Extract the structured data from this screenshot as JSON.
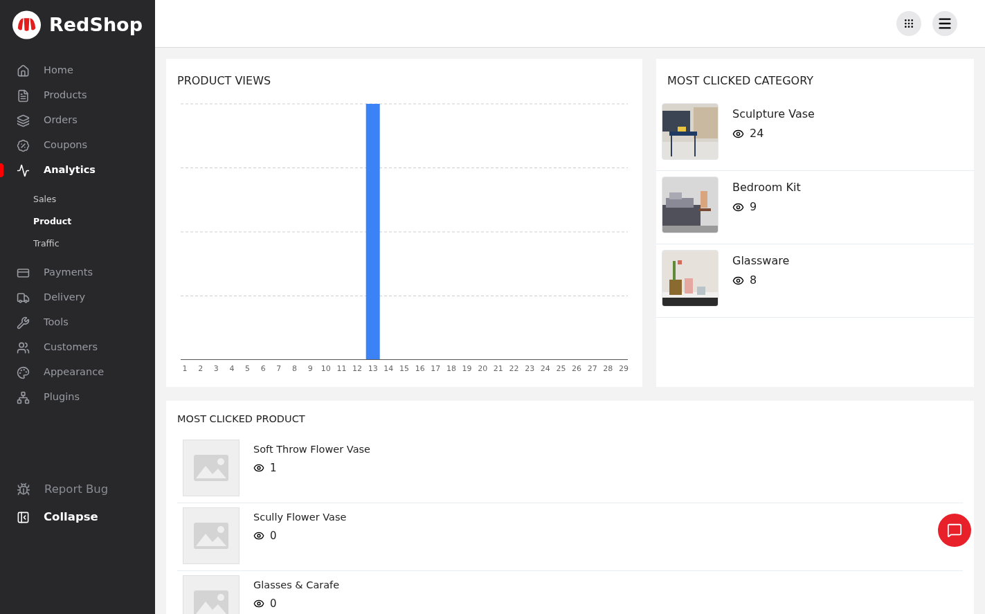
{
  "brand": {
    "name": "RedShop"
  },
  "nav": [
    {
      "label": "Home",
      "selected": false
    },
    {
      "label": "Products",
      "selected": false
    },
    {
      "label": "Orders",
      "selected": false
    },
    {
      "label": "Coupons",
      "selected": false
    },
    {
      "label": "Analytics",
      "selected": true,
      "children": [
        {
          "label": "Sales",
          "selected": false
        },
        {
          "label": "Product",
          "selected": true
        },
        {
          "label": "Traffic",
          "selected": false
        }
      ]
    },
    {
      "label": "Payments",
      "selected": false
    },
    {
      "label": "Delivery",
      "selected": false
    },
    {
      "label": "Tools",
      "selected": false
    },
    {
      "label": "Customers",
      "selected": false
    },
    {
      "label": "Appearance",
      "selected": false
    },
    {
      "label": "Plugins",
      "selected": false
    }
  ],
  "sidebar_footer": [
    {
      "label": "Report Bug",
      "kind": "bug"
    },
    {
      "label": "Collapse",
      "kind": "collapse"
    }
  ],
  "product_views": {
    "title": "PRODUCT VIEWS",
    "days": [
      {
        "label": "1",
        "peak": false
      },
      {
        "label": "2",
        "peak": false
      },
      {
        "label": "3",
        "peak": false
      },
      {
        "label": "4",
        "peak": false
      },
      {
        "label": "5",
        "peak": false
      },
      {
        "label": "6",
        "peak": false
      },
      {
        "label": "7",
        "peak": false
      },
      {
        "label": "8",
        "peak": false
      },
      {
        "label": "9",
        "peak": false
      },
      {
        "label": "10",
        "peak": false
      },
      {
        "label": "11",
        "peak": false
      },
      {
        "label": "12",
        "peak": false
      },
      {
        "label": "13",
        "peak": true
      },
      {
        "label": "14",
        "peak": false
      },
      {
        "label": "15",
        "peak": false
      },
      {
        "label": "16",
        "peak": false
      },
      {
        "label": "17",
        "peak": false
      },
      {
        "label": "18",
        "peak": false
      },
      {
        "label": "19",
        "peak": false
      },
      {
        "label": "20",
        "peak": false
      },
      {
        "label": "21",
        "peak": false
      },
      {
        "label": "22",
        "peak": false
      },
      {
        "label": "23",
        "peak": false
      },
      {
        "label": "24",
        "peak": false
      },
      {
        "label": "25",
        "peak": false
      },
      {
        "label": "26",
        "peak": false
      },
      {
        "label": "27",
        "peak": false
      },
      {
        "label": "28",
        "peak": false
      },
      {
        "label": "29",
        "peak": false
      }
    ]
  },
  "most_clicked_category": {
    "title": "MOST CLICKED CATEGORY",
    "items": [
      {
        "name": "Sculpture Vase",
        "views": "24"
      },
      {
        "name": "Bedroom Kit",
        "views": "9"
      },
      {
        "name": "Glassware",
        "views": "8"
      }
    ]
  },
  "most_clicked_product": {
    "title": "MOST CLICKED PRODUCT",
    "items": [
      {
        "name": "Soft Throw Flower Vase",
        "views": "1"
      },
      {
        "name": "Scully Flower Vase",
        "views": "0"
      },
      {
        "name": "Glasses & Carafe",
        "views": "0"
      }
    ]
  }
}
